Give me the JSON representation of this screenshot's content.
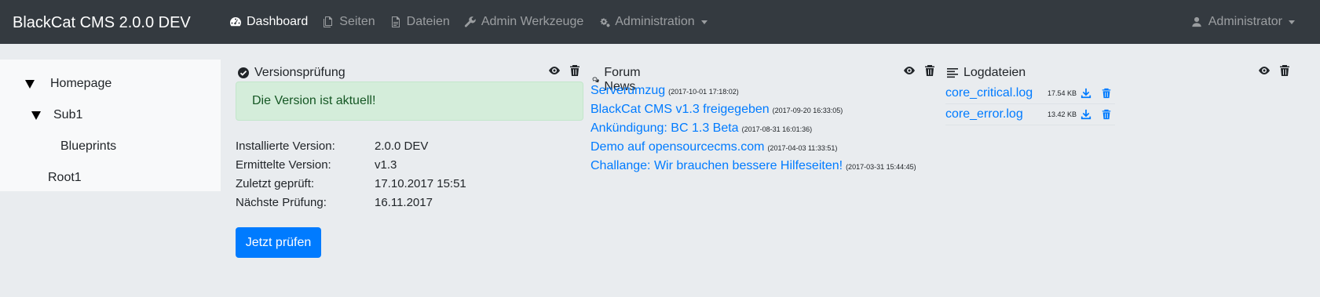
{
  "app": {
    "brand": "BlackCat CMS 2.0.0 DEV"
  },
  "nav": {
    "items": [
      {
        "label": "Dashboard",
        "icon": "dashboard-icon",
        "active": true
      },
      {
        "label": "Seiten",
        "icon": "pages-icon"
      },
      {
        "label": "Dateien",
        "icon": "file-icon"
      },
      {
        "label": "Admin Werkzeuge",
        "icon": "wrench-icon"
      },
      {
        "label": "Administration",
        "icon": "gears-icon",
        "dropdown": true
      }
    ],
    "user": {
      "label": "Administrator",
      "icon": "user-icon"
    }
  },
  "sidebar": {
    "tree": [
      {
        "label": "Homepage",
        "expanded": true
      },
      {
        "label": "Sub1",
        "expanded": true
      },
      {
        "label": "Blueprints"
      },
      {
        "label": "Root1"
      }
    ]
  },
  "version_panel": {
    "title": "Versionsprüfung",
    "alert": "Die Version ist aktuell!",
    "rows": [
      {
        "label": "Installierte Version:",
        "value": "2.0.0 DEV"
      },
      {
        "label": "Ermittelte Version:",
        "value": "v1.3"
      },
      {
        "label": "Zuletzt geprüft:",
        "value": "17.10.2017 15:51"
      },
      {
        "label": "Nächste Prüfung:",
        "value": "16.11.2017"
      }
    ],
    "button": "Jetzt prüfen"
  },
  "news_panel": {
    "title": "Forum News",
    "items": [
      {
        "title": "Serverumzug",
        "date": "(2017-10-01 17:18:02)"
      },
      {
        "title": "BlackCat CMS v1.3 freigegeben",
        "date": "(2017-09-20 16:33:05)"
      },
      {
        "title": "Ankündigung: BC 1.3 Beta",
        "date": "(2017-08-31 16:01:36)"
      },
      {
        "title": "Demo auf opensourcecms.com",
        "date": "(2017-04-03 11:33:51)"
      },
      {
        "title": "Challange: Wir brauchen bessere Hilfeseiten!",
        "date": "(2017-03-31 15:44:45)"
      }
    ]
  },
  "log_panel": {
    "title": "Logdateien",
    "files": [
      {
        "name": "core_critical.log",
        "size": "17.54 KB"
      },
      {
        "name": "core_error.log",
        "size": "13.42 KB"
      }
    ]
  },
  "colors": {
    "navbar": "#343a40",
    "accent": "#007bff",
    "alert_bg": "#d4edda",
    "alert_text": "#155724"
  }
}
